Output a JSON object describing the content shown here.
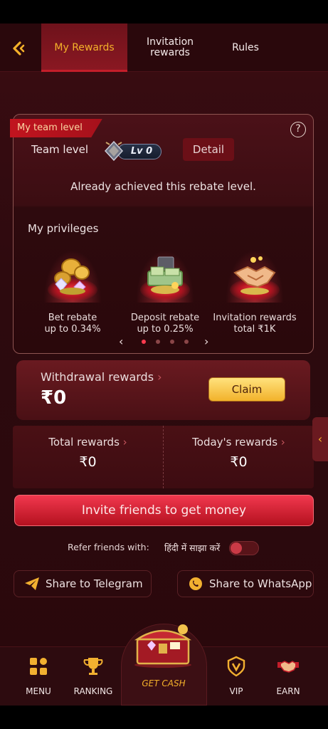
{
  "tabs": [
    {
      "label": "My Rewards",
      "active": true
    },
    {
      "label": "Invitation rewards",
      "active": false
    },
    {
      "label": "Rules",
      "active": false
    }
  ],
  "team": {
    "tag": "My team level",
    "label": "Team level",
    "level": "Lv 0",
    "detail": "Detail",
    "achieved": "Already achieved this rebate level.",
    "privileges_title": "My privileges",
    "privileges": [
      {
        "line1": "Bet rebate",
        "line2": "up to 0.34%"
      },
      {
        "line1": "Deposit rebate",
        "line2": "up to 0.25%"
      },
      {
        "line1": "Invitation rewards",
        "line2": "total ₹1K"
      }
    ],
    "pager": {
      "prev": "‹",
      "next": "›",
      "dots": 4,
      "active_index": 0
    }
  },
  "withdrawal": {
    "label": "Withdrawal rewards",
    "value": "₹0",
    "claim": "Claim"
  },
  "totals": {
    "total_label": "Total rewards",
    "total_value": "₹0",
    "today_label": "Today's rewards",
    "today_value": "₹0"
  },
  "invite": {
    "label": "Invite friends to get money"
  },
  "refer": {
    "label": "Refer friends with:",
    "language": "हिंदी में साझा करें"
  },
  "share": {
    "telegram": "Share to Telegram",
    "whatsapp": "Share to WhatsApp"
  },
  "nav": {
    "menu": "MENU",
    "ranking": "RANKING",
    "get_cash": "GET CASH",
    "vip": "VIP",
    "earn": "EARN"
  },
  "colors": {
    "accent": "#f4b12a",
    "primary_red": "#c41e2a",
    "background": "#2d0a0e"
  }
}
